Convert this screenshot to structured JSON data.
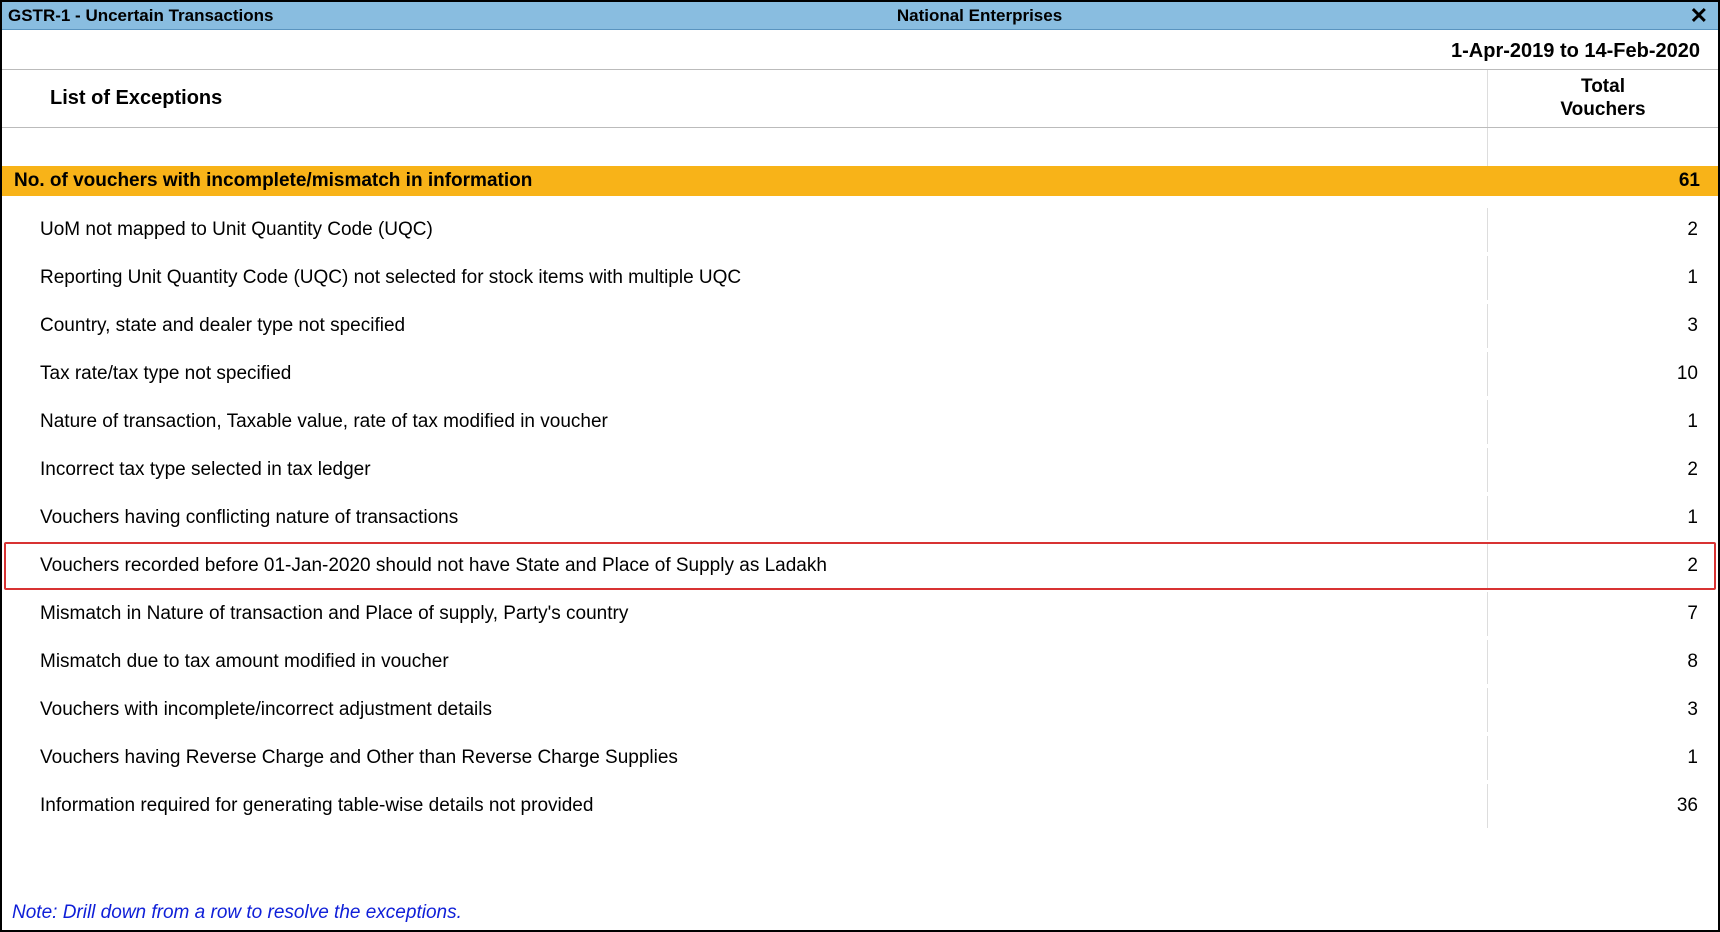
{
  "titlebar": {
    "left": "GSTR-1  -  Uncertain Transactions",
    "center": "National Enterprises",
    "close_glyph": "✕"
  },
  "period": "1-Apr-2019 to 14-Feb-2020",
  "header": {
    "list_label": "List of Exceptions",
    "total_line1": "Total",
    "total_line2": "Vouchers"
  },
  "summary": {
    "label": "No. of vouchers with incomplete/mismatch in information",
    "count": "61"
  },
  "rows": [
    {
      "label": "UoM not mapped to Unit Quantity Code (UQC)",
      "count": "2",
      "highlighted": false
    },
    {
      "label": "Reporting Unit Quantity Code (UQC) not selected for stock items with multiple UQC",
      "count": "1",
      "highlighted": false
    },
    {
      "label": "Country, state and dealer type not specified",
      "count": "3",
      "highlighted": false
    },
    {
      "label": "Tax rate/tax type not specified",
      "count": "10",
      "highlighted": false
    },
    {
      "label": "Nature of transaction, Taxable value, rate of tax modified in voucher",
      "count": "1",
      "highlighted": false
    },
    {
      "label": "Incorrect tax type selected in tax ledger",
      "count": "2",
      "highlighted": false
    },
    {
      "label": "Vouchers having conflicting nature of transactions",
      "count": "1",
      "highlighted": false
    },
    {
      "label": "Vouchers recorded before 01-Jan-2020 should not have State and Place of Supply as Ladakh",
      "count": "2",
      "highlighted": true
    },
    {
      "label": "Mismatch in Nature of transaction and Place of supply, Party's country",
      "count": "7",
      "highlighted": false
    },
    {
      "label": "Mismatch due to tax amount modified in voucher",
      "count": "8",
      "highlighted": false
    },
    {
      "label": "Vouchers with incomplete/incorrect adjustment details",
      "count": "3",
      "highlighted": false
    },
    {
      "label": "Vouchers having Reverse Charge and Other than Reverse Charge Supplies",
      "count": "1",
      "highlighted": false
    },
    {
      "label": "Information required for generating table-wise details not provided",
      "count": "36",
      "highlighted": false
    }
  ],
  "note": "Note: Drill down from a row to resolve the exceptions."
}
